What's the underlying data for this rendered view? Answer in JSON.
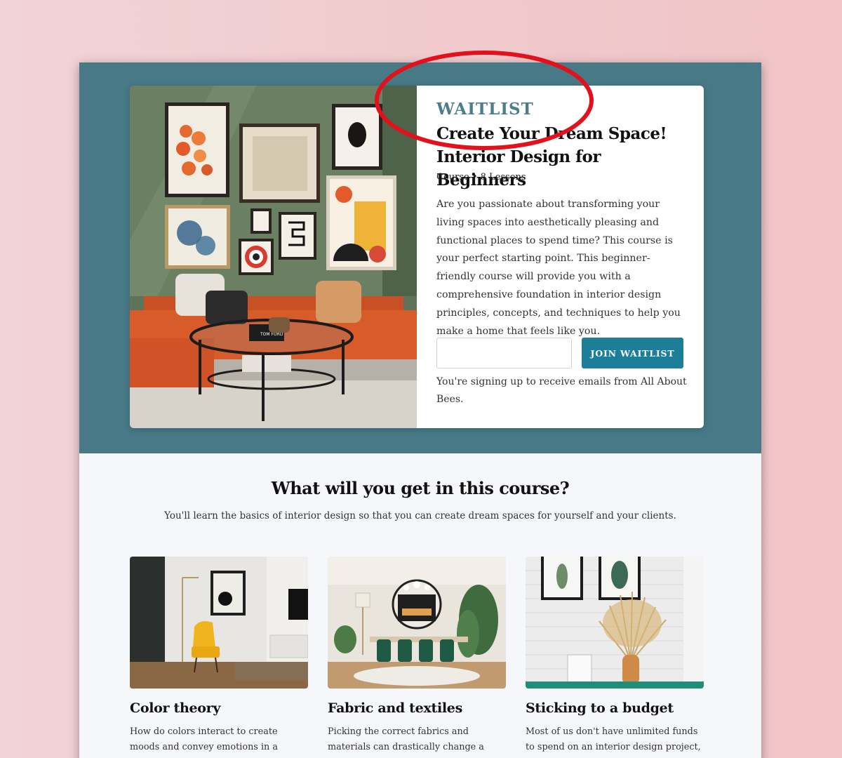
{
  "hero": {
    "label": "WAITLIST",
    "title": "Create Your Dream Space! Interior Design for Beginners",
    "meta": "Course  •  8 Lessons",
    "description": "Are you passionate about transforming your living spaces into aesthetically pleasing and functional places to spend time? This course is your perfect starting point. This beginner-friendly course will provide you with a comprehensive foundation in interior design principles, concepts, and techniques to help you make a home that feels like you.",
    "email_placeholder": "",
    "join_button": "JOIN WAITLIST",
    "consent": "You're signing up to receive emails from All About Bees.",
    "image_art_text": "TOM FORD"
  },
  "section": {
    "title": "What will you get in this course?",
    "subtitle": "You'll learn the basics of interior design so that you can create dream spaces for yourself and your clients."
  },
  "features": [
    {
      "title": "Color theory",
      "text": "How do colors interact to create moods and convey emotions in a space? You'll"
    },
    {
      "title": "Fabric and textiles",
      "text": "Picking the correct fabrics and materials can drastically change a space. These are"
    },
    {
      "title": "Sticking to a budget",
      "text": "Most of us don't have unlimited funds to spend on an interior design project, so"
    }
  ],
  "colors": {
    "hero_background": "#477987",
    "accent_button": "#1c7e98",
    "waitlist_label": "#4c7d8c",
    "annotation_circle": "#e3111b"
  }
}
